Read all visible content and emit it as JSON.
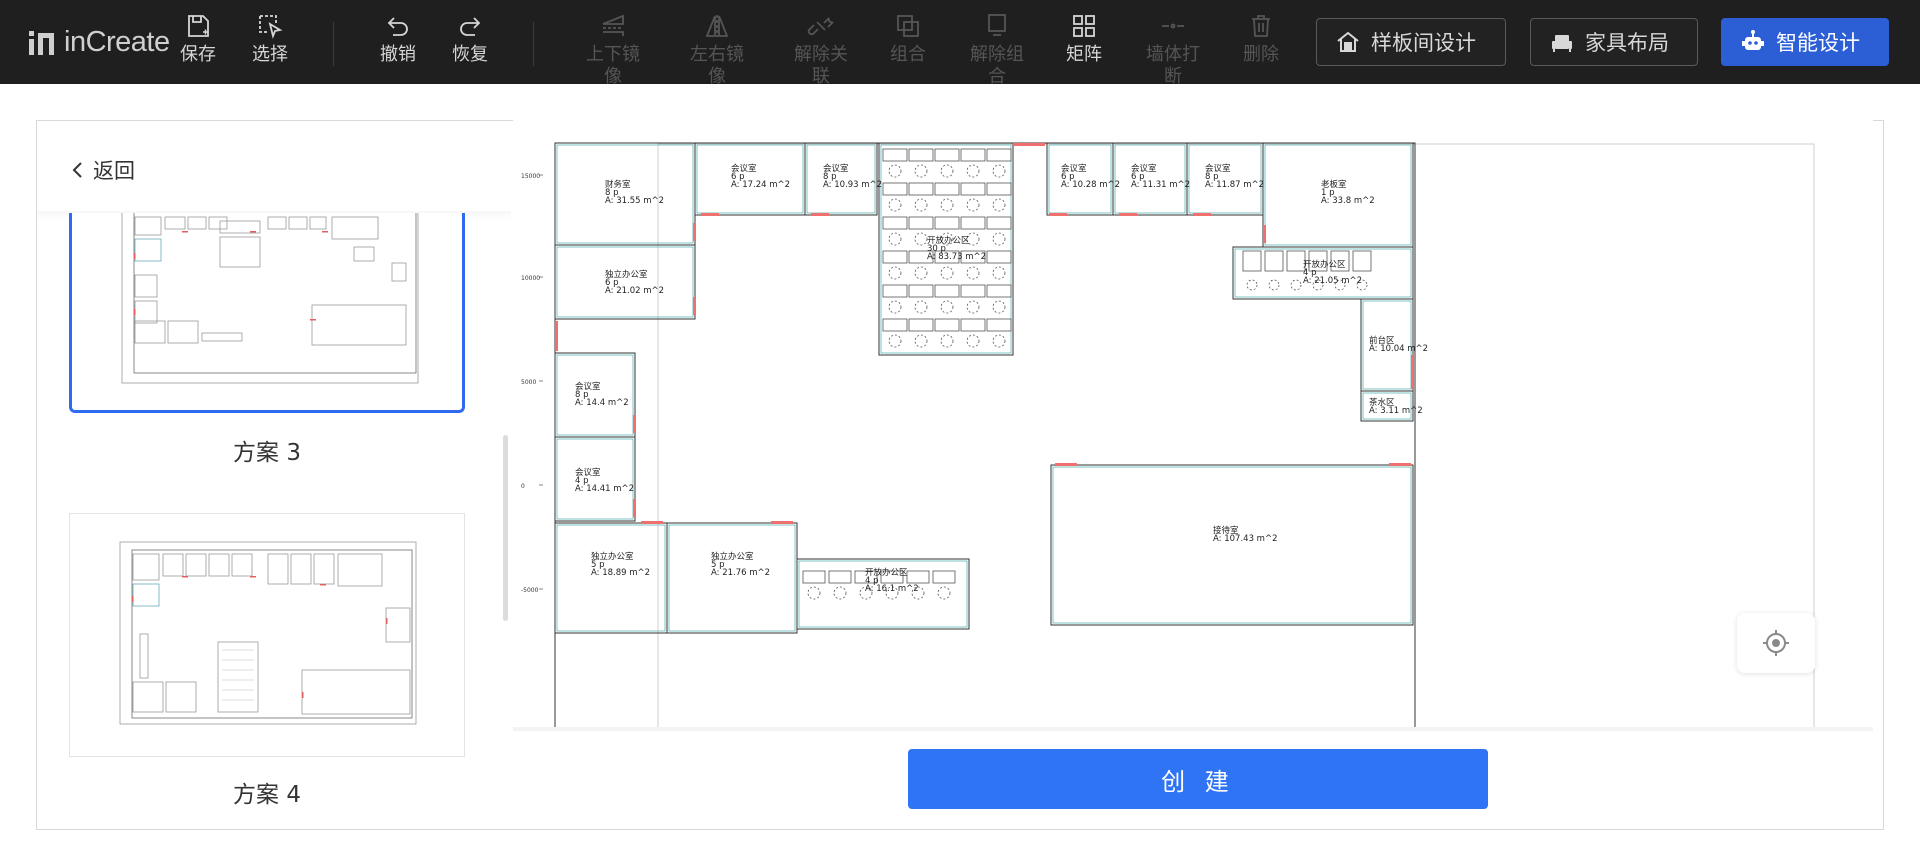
{
  "app": {
    "logo_text": "inCreate"
  },
  "toolbar": {
    "save": "保存",
    "select": "选择",
    "undo": "撤销",
    "redo": "恢复",
    "flip_vertical": "上下镜像",
    "flip_horizontal": "左右镜像",
    "unlink": "解除关联",
    "group": "组合",
    "ungroup": "解除组合",
    "matrix": "矩阵",
    "wall_break": "墙体打断",
    "delete": "删除",
    "showroom_design": "样板间设计",
    "furniture_layout": "家具布局",
    "smart_design": "智能设计"
  },
  "colors": {
    "accent": "#2f74f5",
    "toolbar_bg": "#1f1f1f",
    "wall": "#5fb5b5",
    "door": "#f05a5a"
  },
  "panel": {
    "back": "返回",
    "create": "创 建",
    "schemes": [
      {
        "label": "方案 3",
        "selected": true
      },
      {
        "label": "方案 4",
        "selected": false
      }
    ]
  },
  "plan": {
    "axis_ticks": [
      "15000",
      "10000",
      "5000",
      "0",
      "-5000"
    ],
    "rooms": [
      {
        "name": "财务室",
        "people": "8 p",
        "area": "A: 31.55 m^2"
      },
      {
        "name": "会议室",
        "people": "6 p",
        "area": "A: 17.24 m^2"
      },
      {
        "name": "会议室",
        "people": "8 p",
        "area": "A: 10.93 m^2"
      },
      {
        "name": "开放办公区",
        "people": "30 p",
        "area": "A: 83.73 m^2"
      },
      {
        "name": "会议室",
        "people": "6 p",
        "area": "A: 10.28 m^2"
      },
      {
        "name": "会议室",
        "people": "6 p",
        "area": "A: 11.31 m^2"
      },
      {
        "name": "会议室",
        "people": "8 p",
        "area": "A: 11.87 m^2"
      },
      {
        "name": "老板室",
        "people": "1 p",
        "area": "A: 33.8 m^2"
      },
      {
        "name": "独立办公室",
        "people": "6 p",
        "area": "A: 21.02 m^2"
      },
      {
        "name": "开放办公区",
        "people": "4 p",
        "area": "A: 21.05 m^2"
      },
      {
        "name": "前台区",
        "people": "",
        "area": "A: 10.04 m^2"
      },
      {
        "name": "茶水区",
        "people": "",
        "area": "A: 3.11 m^2"
      },
      {
        "name": "会议室",
        "people": "8 p",
        "area": "A: 14.4 m^2"
      },
      {
        "name": "会议室",
        "people": "4 p",
        "area": "A: 14.41 m^2"
      },
      {
        "name": "独立办公室",
        "people": "5 p",
        "area": "A: 18.89 m^2"
      },
      {
        "name": "独立办公室",
        "people": "5 p",
        "area": "A: 21.76 m^2"
      },
      {
        "name": "开放办公区",
        "people": "4 p",
        "area": "A: 16.1 m^2"
      },
      {
        "name": "接待室",
        "people": "",
        "area": "A: 107.43 m^2"
      }
    ]
  }
}
